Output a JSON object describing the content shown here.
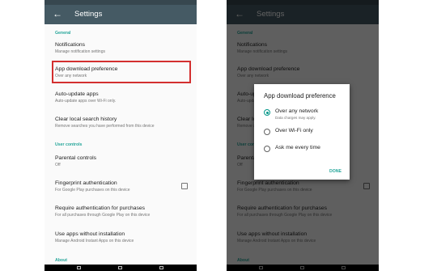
{
  "settings": {
    "title": "Settings",
    "sections": {
      "general": "General",
      "user_controls": "User controls",
      "about": "About"
    },
    "items": [
      {
        "title": "Notifications",
        "subtitle": "Manage notification settings"
      },
      {
        "title": "App download preference",
        "subtitle": "Over any network"
      },
      {
        "title": "Auto-update apps",
        "subtitle": "Auto-update apps over Wi-Fi only."
      },
      {
        "title": "Clear local search history",
        "subtitle": "Remove searches you have performed from this device"
      },
      {
        "title": "Parental controls",
        "subtitle": "Off"
      },
      {
        "title": "Fingerprint authentication",
        "subtitle": "For Google Play purchases on this device"
      },
      {
        "title": "Require authentication for purchases",
        "subtitle": "For all purchases through Google Play on this device"
      },
      {
        "title": "Use apps without installation",
        "subtitle": "Manage Android Instant Apps on this device"
      }
    ]
  },
  "dialog": {
    "title": "App download preference",
    "options": [
      {
        "label": "Over any network",
        "sub": "Data charges may apply.",
        "selected": true
      },
      {
        "label": "Over Wi-Fi only",
        "selected": false
      },
      {
        "label": "Ask me every time",
        "selected": false
      }
    ],
    "done": "DONE"
  },
  "colors": {
    "appbar": "#455a64",
    "accent": "#26a69a",
    "highlight": "#d32f2f"
  }
}
